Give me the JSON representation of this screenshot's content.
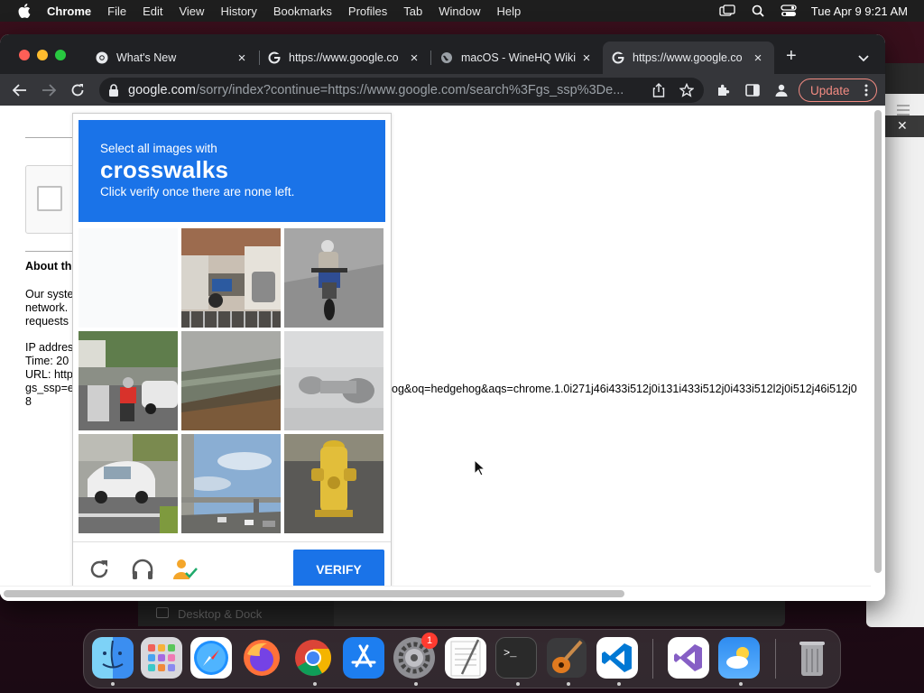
{
  "menubar": {
    "app_name": "Chrome",
    "items": [
      "File",
      "Edit",
      "View",
      "History",
      "Bookmarks",
      "Profiles",
      "Tab",
      "Window",
      "Help"
    ],
    "clock": "Tue Apr 9  9:21 AM"
  },
  "tabs": [
    {
      "title": "What's New",
      "favicon": "chrome-icon",
      "active": false
    },
    {
      "title": "https://www.google.co",
      "favicon": "google-icon",
      "active": false
    },
    {
      "title": "macOS - WineHQ Wiki",
      "favicon": "globe-icon",
      "active": false
    },
    {
      "title": "https://www.google.co",
      "favicon": "google-icon",
      "active": true
    }
  ],
  "toolbar": {
    "url_host": "google.com",
    "url_path": "/sorry/index?continue=https://www.google.com/search%3Fgs_ssp%3De...",
    "update_label": "Update"
  },
  "page": {
    "about_heading": "About th",
    "para1": [
      "Our syste",
      "network.",
      "requests"
    ],
    "para2": [
      "IP addres",
      "Time: 20",
      "URL: http",
      "gs_ssp=e",
      "8"
    ],
    "query_line": "og&oq=hedgehog&aqs=chrome.1.0i271j46i433i512j0i131i433i512j0i433i512l2j0i512j46i512j0"
  },
  "captcha": {
    "header_line1": "Select all images with",
    "header_keyword": "crosswalks",
    "header_line3": "Click verify once there are none left.",
    "verify_label": "VERIFY",
    "accent": "#1a73e8",
    "tiles": [
      {
        "name": "tile-blank",
        "content": "fading-blank"
      },
      {
        "name": "tile-porch-scooter",
        "content": "porch with scooter and drum"
      },
      {
        "name": "tile-motorcyclist",
        "content": "rider on motorcycle"
      },
      {
        "name": "tile-street-scooter",
        "content": "street with red-shirt scooter rider"
      },
      {
        "name": "tile-road-guardrail",
        "content": "road with guardrail"
      },
      {
        "name": "tile-faded-motorcycle",
        "content": "faded motorcycle"
      },
      {
        "name": "tile-white-car",
        "content": "white car on road"
      },
      {
        "name": "tile-highway",
        "content": "highway overpass"
      },
      {
        "name": "tile-fire-hydrant",
        "content": "yellow fire hydrant"
      }
    ]
  },
  "desktop": {
    "dock_label": "Desktop & Dock",
    "notification_badge": "1",
    "dock_items": [
      "finder",
      "launchpad",
      "safari",
      "firefox",
      "chrome",
      "app-store",
      "system-settings",
      "textedit",
      "terminal",
      "garageband",
      "vscode",
      "visual-studio",
      "weather",
      "trash"
    ]
  }
}
